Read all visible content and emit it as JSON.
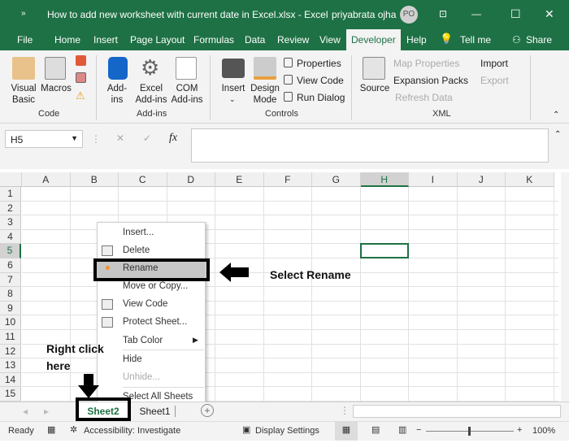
{
  "title": {
    "quick_access": "»",
    "document": "How to add new worksheet with current date in Excel.xlsx  -  Excel",
    "user": "priyabrata ojha",
    "avatar": "PO",
    "minimize": "—",
    "maximize": "☐",
    "close": "✕",
    "ribbon_display": "⊡"
  },
  "tabs": [
    "File",
    "Home",
    "Insert",
    "Page Layout",
    "Formulas",
    "Data",
    "Review",
    "View",
    "Developer",
    "Help",
    "Tell me",
    "Share"
  ],
  "active_tab": "Developer",
  "ribbon": {
    "code": {
      "label": "Code",
      "visual_basic": "Visual\nBasic",
      "macros": "Macros"
    },
    "addins": {
      "label": "Add-ins",
      "addins": "Add-\nins",
      "excel_addins": "Excel\nAdd-ins",
      "com_addins": "COM\nAdd-ins"
    },
    "controls": {
      "label": "Controls",
      "insert": "Insert",
      "design_mode": "Design\nMode",
      "properties": "Properties",
      "view_code": "View Code",
      "run_dialog": "Run Dialog"
    },
    "xml": {
      "label": "XML",
      "source": "Source",
      "map_properties": "Map Properties",
      "expansion_packs": "Expansion Packs",
      "refresh_data": "Refresh Data",
      "import": "Import",
      "export": "Export"
    }
  },
  "formula_bar": {
    "name_box": "H5",
    "cancel": "✕",
    "enter": "✓",
    "fx": "fx",
    "value": ""
  },
  "columns": [
    "A",
    "B",
    "C",
    "D",
    "E",
    "F",
    "G",
    "H",
    "I",
    "J",
    "K"
  ],
  "rows": [
    "1",
    "2",
    "3",
    "4",
    "5",
    "6",
    "7",
    "8",
    "9",
    "10",
    "11",
    "12",
    "13",
    "14",
    "15"
  ],
  "selected_cell": "H5",
  "context_menu": [
    {
      "label": "Insert...",
      "icon": ""
    },
    {
      "label": "Delete",
      "icon": "delete-sheet-icon"
    },
    {
      "label": "Rename",
      "icon": "bullet-icon",
      "highlighted": true
    },
    {
      "label": "Move or Copy...",
      "icon": ""
    },
    {
      "label": "View Code",
      "icon": "view-code-icon"
    },
    {
      "label": "Protect Sheet...",
      "icon": "protect-sheet-icon"
    },
    {
      "label": "Tab Color",
      "icon": "",
      "submenu": true
    },
    {
      "label": "Hide",
      "icon": ""
    },
    {
      "label": "Unhide...",
      "icon": "",
      "disabled": true
    },
    {
      "label": "Select All Sheets",
      "icon": ""
    }
  ],
  "annotations": {
    "select_rename": "Select Rename",
    "right_click_1": "Right click",
    "right_click_2": "here"
  },
  "sheets": [
    {
      "name": "Sheet2",
      "active": true
    },
    {
      "name": "Sheet1",
      "active": false
    }
  ],
  "add_sheet": "+",
  "status": {
    "ready": "Ready",
    "accessibility": "Accessibility: Investigate",
    "display_settings": "Display Settings",
    "zoom": "100%",
    "zoom_out": "−",
    "zoom_in": "+"
  },
  "colors": {
    "excel_green": "#1e7145",
    "highlight": "#c6c6c6",
    "accent_dot": "#f29423"
  }
}
